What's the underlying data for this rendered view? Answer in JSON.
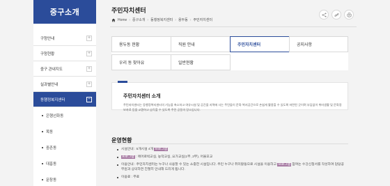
{
  "sidebar": {
    "title": "중구소개",
    "items": [
      {
        "label": "구청안내",
        "expander": "+"
      },
      {
        "label": "구청현황",
        "expander": "+"
      },
      {
        "label": "중구 관내지도",
        "expander": "+"
      },
      {
        "label": "실과별안내",
        "expander": "+"
      },
      {
        "label": "동행정복지센터",
        "expander": "−"
      }
    ],
    "subitems": [
      "은행선화동",
      "목동",
      "중촌동",
      "대흥동",
      "문창동"
    ]
  },
  "header": {
    "title": "주민자치센터",
    "breadcrumb": [
      "Home",
      "중구소개",
      "동행정복지센터",
      "용두동",
      "주민자치센터"
    ]
  },
  "tools": {
    "share": "share-icon",
    "link": "link-icon",
    "print": "print-icon"
  },
  "tabs": [
    "용두동 현황",
    "직원 안내",
    "주민자치센터",
    "공지사항",
    "우리 동 찾아유",
    "일반현황"
  ],
  "intro": {
    "title": "주민자치센터 소개",
    "body": "주민자치센터는 동행정복지센터의 기능을 축소하고 여유시설 및 공간을 지역에 사는 주민들이 문화·복지공간으로 손쉽게 활용할 수 있도록 마련된 곳이며 부담없이 취미생활 및 문화정보자료 등을 교환하고 습득할 수 있도록 주민 공동의 장소입니다."
  },
  "operations": {
    "title": "운영현황",
    "items": [
      {
        "label": "시설안내",
        "text": " : 5개시설 4개 ",
        "hl": "프로그램",
        "tail": ""
      },
      {
        "label": "프로그램",
        "text": " : 에어로빅교실, 농악교실, 요가교실(1부, 2부), 어울모교",
        "hl": "",
        "tail": "",
        "label_hl": true
      },
      {
        "label": "이용안내",
        "text": " : 주민자치센터는 누구나 사용할 수 있는 소중한 시설입니다. 주민 누구나 취미활동으로 시설을 이용하고 ",
        "hl": "프로그램",
        "tail": " 참여는 수강신청서를 작성하여 담당공무원과 상의하면 친절히 안내해 드리게 됩니다."
      },
      {
        "label": "이용료",
        "text": " : 무료",
        "hl": "",
        "tail": ""
      }
    ]
  },
  "colors": {
    "accent": "#2b4c9a",
    "highlight": "#a77ba3"
  }
}
